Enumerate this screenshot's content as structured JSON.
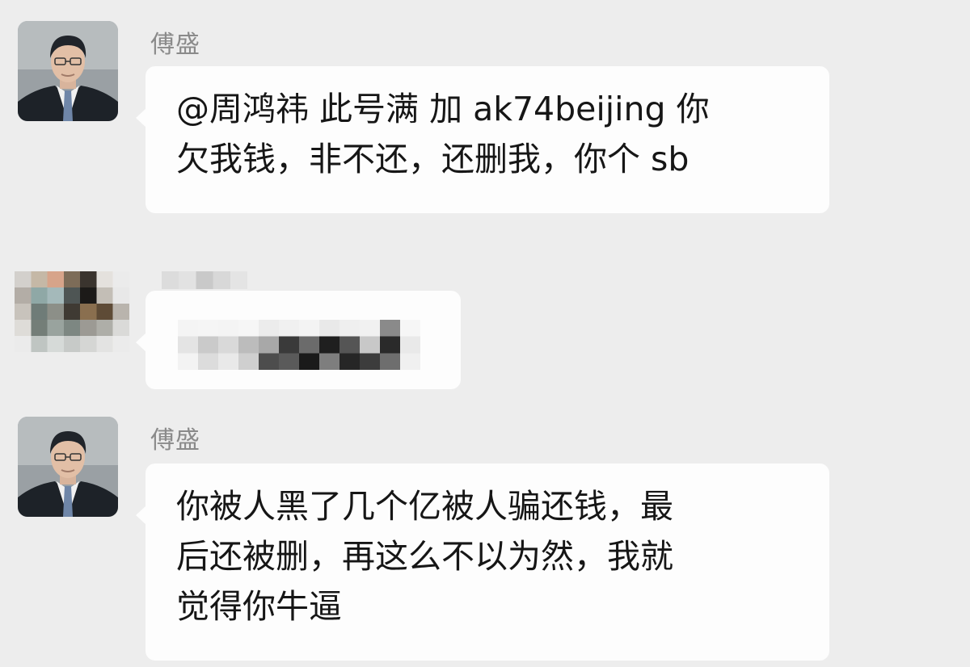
{
  "messages": [
    {
      "sender": "傅盛",
      "avatar_icon": "man-portrait-icon",
      "lines": [
        "@周鸿祎 此号满 加 ak74beijing 你",
        "欠我钱，非不还，还删我，你个 sb"
      ]
    },
    {
      "sender": "",
      "avatar_icon": "pixelated-avatar-icon",
      "lines": []
    },
    {
      "sender": "傅盛",
      "avatar_icon": "man-portrait-icon",
      "lines": [
        "你被人黑了几个亿被人骗还钱，最",
        "后还被删，再这么不以为然，我就",
        "觉得你牛逼"
      ]
    }
  ],
  "colors": {
    "background": "#ededed",
    "bubble": "#fdfdfd",
    "sender_name": "#8a8a8a",
    "text": "#161616"
  }
}
